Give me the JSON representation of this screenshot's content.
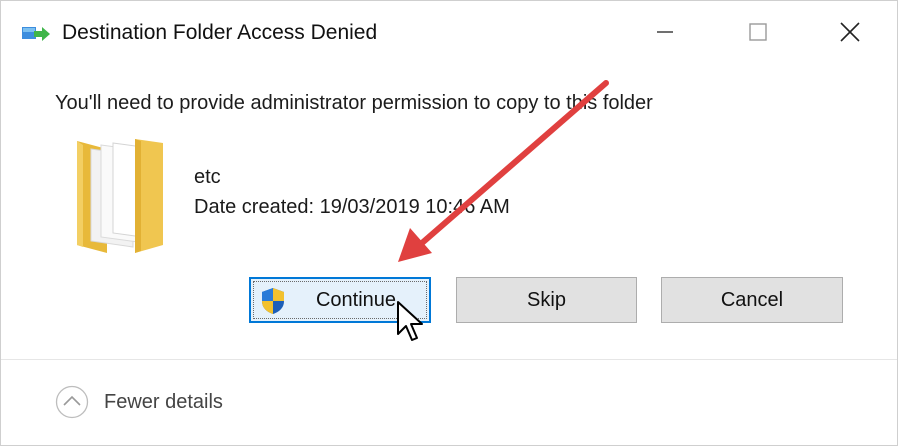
{
  "window": {
    "title": "Destination Folder Access Denied",
    "app_icon": "copy-transfer-icon",
    "controls": {
      "minimize": "minimize-icon",
      "maximize": "maximize-icon",
      "close": "close-icon"
    }
  },
  "message": "You'll need to provide administrator permission to copy to this folder",
  "item": {
    "icon": "folder-icon",
    "name": "etc",
    "date_created": "Date created: 19/03/2019 10:46 AM"
  },
  "buttons": {
    "continue": "Continue",
    "continue_icon": "uac-shield-icon",
    "skip": "Skip",
    "cancel": "Cancel"
  },
  "footer": {
    "toggle_icon": "chevron-up-icon",
    "label": "Fewer details"
  },
  "annotation": {
    "arrow_color": "#e0403f",
    "accent_color": "#0078d7"
  }
}
